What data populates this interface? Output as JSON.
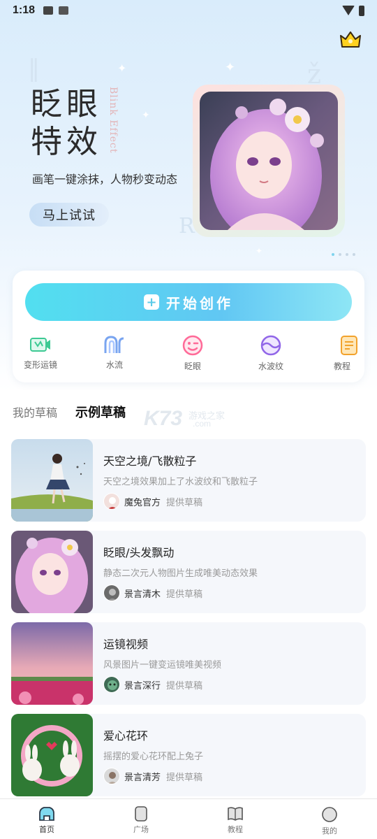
{
  "status_bar": {
    "time": "1:18",
    "left_icons": [
      "image-icon",
      "font-icon"
    ],
    "right_icons": [
      "wifi-icon",
      "battery-icon"
    ]
  },
  "hero": {
    "title_line1": "眨眼",
    "title_line2": "特效",
    "title_en": "Blink Effect",
    "subtitle": "画笔一键涂抹，人物秒变动态",
    "try_button": "马上试试",
    "vip_icon": "crown-icon",
    "carousel": {
      "count": 4,
      "active": 0
    }
  },
  "create": {
    "button_label": "开始创作",
    "tools": [
      {
        "label": "变形运镜",
        "icon": "morph-camera-icon"
      },
      {
        "label": "水流",
        "icon": "water-flow-icon"
      },
      {
        "label": "眨眼",
        "icon": "wink-face-icon"
      },
      {
        "label": "水波纹",
        "icon": "water-ripple-icon"
      },
      {
        "label": "教程",
        "icon": "tutorial-doc-icon"
      }
    ]
  },
  "tabs": [
    {
      "label": "我的草稿",
      "active": false
    },
    {
      "label": "示例草稿",
      "active": true
    }
  ],
  "watermark": {
    "logo": "K73",
    "cn": "游戏之家",
    "domain": ".com"
  },
  "drafts": [
    {
      "title": "天空之境/飞散粒子",
      "desc": "天空之境效果加上了水波纹和飞散粒子",
      "author": "魔兔官方",
      "note": "提供草稿"
    },
    {
      "title": "眨眼/头发飘动",
      "desc": "静态二次元人物图片生成唯美动态效果",
      "author": "景言清木",
      "note": "提供草稿"
    },
    {
      "title": "运镜视频",
      "desc": "风景图片一键变运镜唯美视频",
      "author": "景言深行",
      "note": "提供草稿"
    },
    {
      "title": "爱心花环",
      "desc": "摇摆的爱心花环配上兔子",
      "author": "景言清芳",
      "note": "提供草稿"
    }
  ],
  "bottom_nav": [
    {
      "label": "首页",
      "icon": "home-icon",
      "active": true
    },
    {
      "label": "广场",
      "icon": "square-icon",
      "active": false
    },
    {
      "label": "教程",
      "icon": "book-icon",
      "active": false
    },
    {
      "label": "我的",
      "icon": "profile-icon",
      "active": false
    }
  ],
  "colors": {
    "accent": "#5bd3ef",
    "hero_bg": "#dcedfb",
    "card_bg": "#f5f7fb"
  }
}
